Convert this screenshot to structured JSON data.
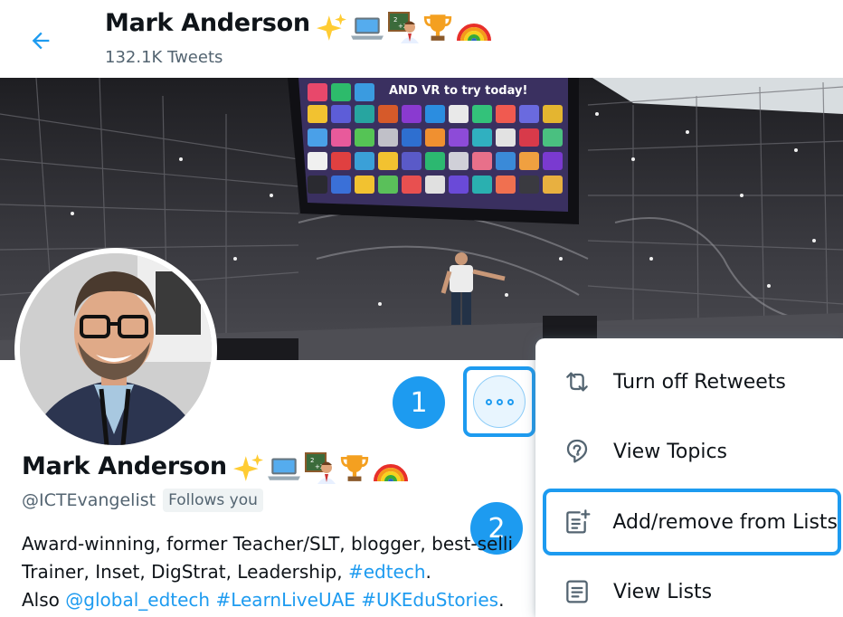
{
  "header": {
    "back_icon": "arrow-left-icon",
    "name": "Mark Anderson",
    "name_emojis": [
      "sparkles-emoji",
      "laptop-emoji",
      "teacher-emoji",
      "trophy-emoji",
      "rainbow-emoji"
    ],
    "tweet_count": "132.1K Tweets"
  },
  "banner": {
    "screen_text": "AND VR to try today!"
  },
  "profile": {
    "name": "Mark Anderson",
    "handle": "@ICTEvangelist",
    "follows_badge": "Follows you",
    "bio": {
      "line1": "Award-winning, former Teacher/SLT, blogger, best-selli",
      "line2_prefix": "Trainer, Inset, DigStrat, Leadership, ",
      "line2_tag": "#edtech",
      "line2_suffix": ".",
      "line3_prefix": "Also ",
      "line3_mention": "@global_edtech",
      "line3_tag1": "#LearnLiveUAE",
      "line3_tag2": "#UKEduStories",
      "line3_suffix": "."
    }
  },
  "more_button": {
    "icon": "more-horizontal-icon"
  },
  "steps": {
    "step1": "1",
    "step2": "2"
  },
  "menu": {
    "items": [
      {
        "label": "Turn off Retweets",
        "icon": "retweet-icon"
      },
      {
        "label": "View Topics",
        "icon": "topics-icon"
      },
      {
        "label": "Add/remove from Lists",
        "icon": "list-add-icon"
      },
      {
        "label": "View Lists",
        "icon": "list-icon"
      }
    ]
  },
  "colors": {
    "accent": "#1d9bf0",
    "text": "#0f1419",
    "secondary_text": "#536471"
  }
}
